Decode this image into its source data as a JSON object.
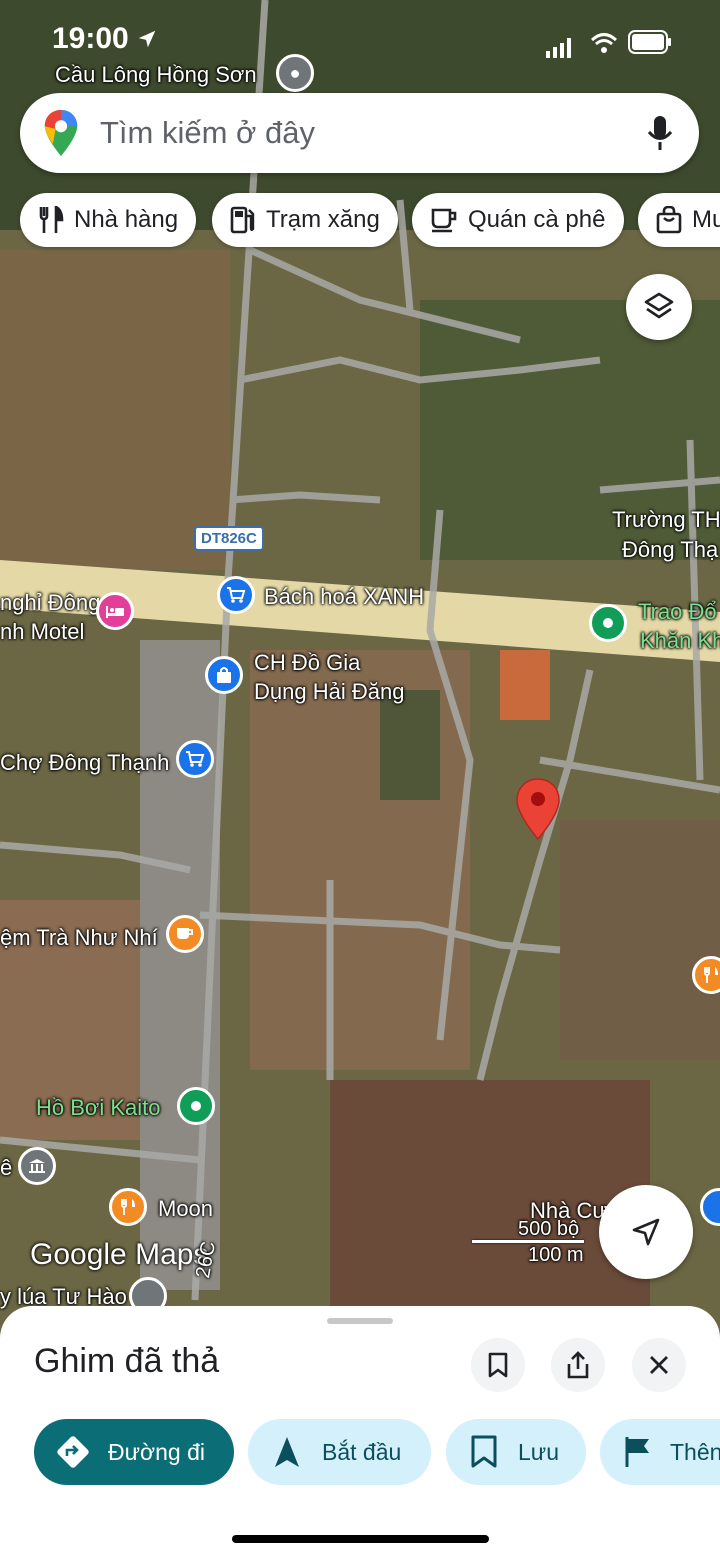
{
  "status_bar": {
    "time": "19:00"
  },
  "search": {
    "placeholder": "Tìm kiếm ở đây",
    "top_place": "Cầu Lông Hồng Sơn"
  },
  "chips": [
    {
      "label": "Nhà hàng",
      "icon": "restaurant-icon"
    },
    {
      "label": "Trạm xăng",
      "icon": "gas-station-icon"
    },
    {
      "label": "Quán cà phê",
      "icon": "coffee-icon"
    },
    {
      "label": "Mu",
      "icon": "shopping-bag-icon"
    }
  ],
  "map_labels": {
    "road_badge": "DT826C",
    "school_1": "Trường TH",
    "school_2": "Đông Thạ",
    "bach_hoa": "Bách hoá XANH",
    "motel_1": "nghỉ Đông",
    "motel_2": "nh Motel",
    "trao_1": "Trao Đổ",
    "trao_2": "Khăn Kh",
    "ch_1": "CH Đồ Gia",
    "ch_2": "Dụng Hải Đăng",
    "cho": "Chợ Đông Thạnh",
    "tra": "ệm Trà Như Nhí",
    "hoboi": "Hồ Bơi Kaito",
    "moon": "Moon",
    "nha": "Nhà Cư",
    "logo": "Google Maps",
    "bottom_place": "y lúa Tư Hào",
    "road_bottom": "26C",
    "e": "ê",
    "scale_ft": "500 bộ",
    "scale_m": "100 m"
  },
  "sheet": {
    "title": "Ghim đã thả",
    "actions": [
      {
        "label": "Đường đi",
        "icon": "directions-icon"
      },
      {
        "label": "Bắt đầu",
        "icon": "navigation-arrow-icon"
      },
      {
        "label": "Lưu",
        "icon": "bookmark-icon"
      },
      {
        "label": "Thên",
        "icon": "flag-icon"
      }
    ]
  },
  "colors": {
    "accent": "#0b6e77",
    "chip_light": "#d3f0fb",
    "pin": "#ea4335",
    "poi_blue": "#1a73e8",
    "poi_green": "#0f9d58",
    "poi_orange": "#f28b24",
    "poi_pink": "#e23f9a",
    "poi_gray": "#70757a"
  }
}
